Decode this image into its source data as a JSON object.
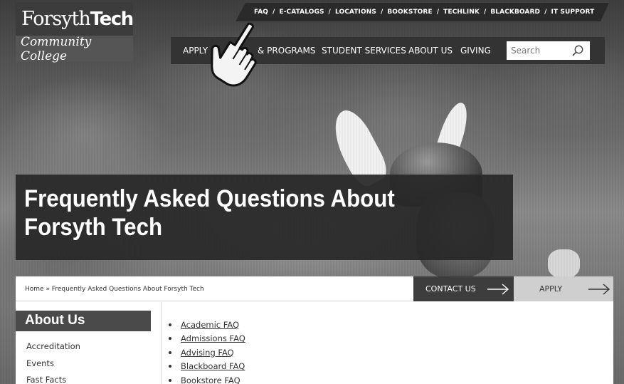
{
  "logo": {
    "name_regular": "Forsyth",
    "name_bold": "Tech",
    "subtitle": "Community College"
  },
  "utility_nav": [
    {
      "label": "FAQ"
    },
    {
      "label": "E-CATALOGS"
    },
    {
      "label": "LOCATIONS"
    },
    {
      "label": "BOOKSTORE"
    },
    {
      "label": "TECHLINK"
    },
    {
      "label": "BLACKBOARD"
    },
    {
      "label": "IT SUPPORT"
    }
  ],
  "main_nav": [
    {
      "label": "APPLY"
    },
    {
      "label": "& PROGRAMS"
    },
    {
      "label": "STUDENT SERVICES"
    },
    {
      "label": "ABOUT US"
    },
    {
      "label": "GIVING"
    }
  ],
  "search": {
    "placeholder": "Search"
  },
  "page": {
    "title": "Frequently Asked Questions About Forsyth Tech",
    "breadcrumb": "Home » Frequently Asked Questions About Forsyth Tech"
  },
  "cta": {
    "contact_label": "CONTACT US",
    "apply_label": "APPLY"
  },
  "sidebar": {
    "heading": "About Us",
    "items": [
      "Accreditation",
      "Events",
      "Fast Facts"
    ]
  },
  "faq_links": [
    "Academic FAQ",
    "Admissions FAQ",
    "Advising FAQ",
    "Blackboard FAQ",
    "Bookstore FAQ"
  ],
  "colors": {
    "nav_background": "#333333",
    "title_band": "#282828",
    "contact_button": "#3d3d3d",
    "apply_button": "#cfcfcf"
  },
  "icons": [
    "search-icon",
    "arrow-right-icon",
    "hand-cursor-icon"
  ]
}
